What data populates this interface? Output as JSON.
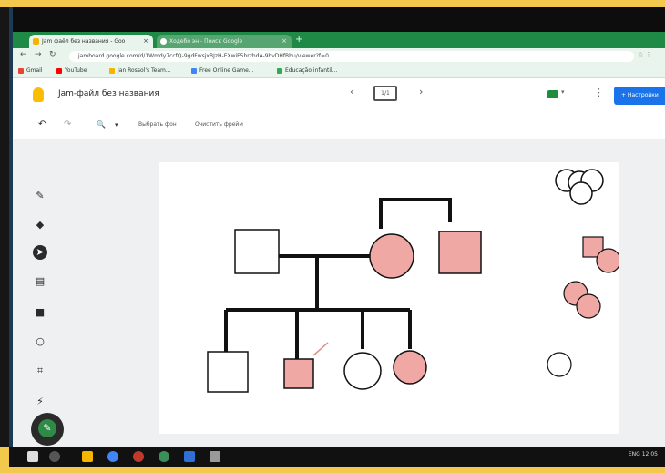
{
  "browser": {
    "tabs": [
      {
        "title": "Jam фаёл без названия - Goo",
        "close": "×"
      },
      {
        "title": "Ходебо эн - Поиск Google",
        "close": "×"
      }
    ],
    "new_tab": "+",
    "url": "jamboard.google.com/d/1Wmdy7ccfQ-9gdFwsjxBJzH-EXwiF5hrzhdA-9hvDHfBbu/viewer?f=0",
    "bookmarks": [
      {
        "label": "Gmail",
        "color": "#ea4335"
      },
      {
        "label": "YouTube",
        "color": "#ff0000"
      },
      {
        "label": "Jan Rossol's Team...",
        "color": "#f4b400"
      },
      {
        "label": "Free Online Game...",
        "color": "#4285f4"
      },
      {
        "label": "Educação infantil...",
        "color": "#34a853"
      }
    ]
  },
  "app": {
    "title": "Jam-файл без названия",
    "page_indicator": "1/1",
    "share_label": "+ Настройки"
  },
  "toolbar": {
    "undo": "↶",
    "redo": "↷",
    "zoom": "🔍",
    "zoom_caret": "▾",
    "set_background": "Выбрать фон",
    "clear_frame": "Очистить фрейм"
  },
  "tools": [
    "pen-icon",
    "eraser-icon",
    "select-icon",
    "sticky-note-icon",
    "image-icon",
    "circle-icon",
    "text-box-icon",
    "laser-icon"
  ],
  "diagram": {
    "type": "pedigree",
    "colors": {
      "affected": "#f0a8a4",
      "unaffected": "#ffffff",
      "line": "#111111"
    },
    "parents": [
      {
        "shape": "square",
        "affected": false
      },
      {
        "shape": "circle",
        "affected": true
      }
    ],
    "grandparents": [
      {
        "shape": "square",
        "affected": true
      }
    ],
    "children": [
      {
        "shape": "square",
        "affected": false
      },
      {
        "shape": "square",
        "affected": true
      },
      {
        "shape": "circle",
        "affected": false
      },
      {
        "shape": "circle",
        "affected": true
      }
    ],
    "palette": {
      "circles": 4,
      "squares": 2,
      "affected_circles": 3
    }
  },
  "taskbar": {
    "tray": "ENG 12:05"
  }
}
